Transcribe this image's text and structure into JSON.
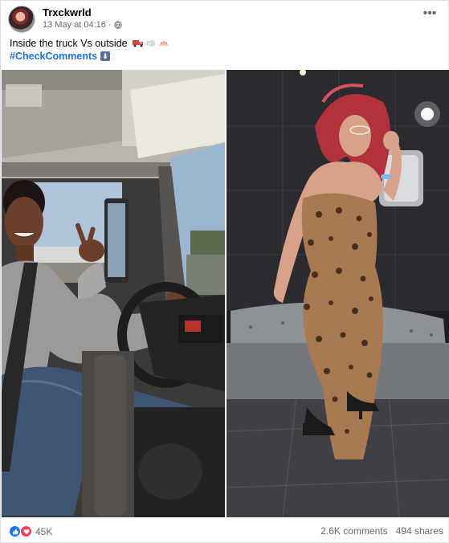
{
  "post": {
    "author": "Trxckwrld",
    "timestamp": "13 May at 04:16",
    "separator": "·",
    "privacy_icon": "globe-icon",
    "menu_icon": "more-options-icon",
    "caption": "Inside the truck Vs outside",
    "caption_emojis": [
      "truck-emoji",
      "dash-emoji",
      "nail-emoji"
    ],
    "hashtag": "#CheckComments",
    "hashtag_icon": "down-arrow-icon",
    "hashtag_icon_glyph": "⬇"
  },
  "reactions": {
    "icons": [
      "like-icon",
      "love-icon"
    ],
    "count": "45K"
  },
  "stats": {
    "comments": "2.6K comments",
    "shares": "494 shares"
  },
  "colors": {
    "link": "#216fdb",
    "secondary_text": "#65676b",
    "like": "#1877f2",
    "love": "#f33e58"
  }
}
